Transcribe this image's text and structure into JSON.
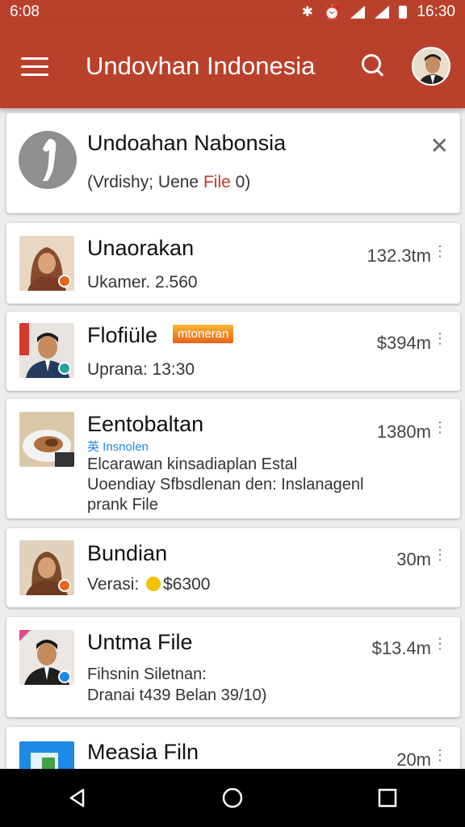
{
  "status": {
    "time_left": "6:08",
    "time_right": "16:30"
  },
  "app": {
    "title": "Undovhan Indonesia"
  },
  "top_card": {
    "title": "Undoahan Nabonsia",
    "sub_prefix": "(Vrdishy; Uene ",
    "sub_file": "File",
    "sub_suffix": " 0)"
  },
  "items": [
    {
      "title": "Unaorakan",
      "sub": "Ukamer.  2.560",
      "meta": "132.3tm"
    },
    {
      "title": "Flofiüle",
      "tag": "mtoneran",
      "sub": "Uprana: 13:30",
      "meta": "$394m"
    },
    {
      "title": "Eentobaltan",
      "tag": "英 Insnolen",
      "lines": [
        "Elcarawan kinsadiaplan Estal",
        "Uoendiay Sfbsdlenan den: Inslanagenl",
        "prank File"
      ],
      "meta": "1380m"
    },
    {
      "title": "Bundian",
      "sub_prefix": "Verasi: ",
      "sub": "$6300",
      "meta": "30m"
    },
    {
      "title": "Untma File",
      "lines": [
        "Fihsnin Siletnan:",
        "Dranai t439 Belan 39/10)"
      ],
      "meta": "$13.4m"
    },
    {
      "title": "Measia Filn",
      "meta": "20m"
    }
  ],
  "colors": {
    "appbar": "#b9412c",
    "accent_orange": "#e8641b",
    "accent_teal": "#26a69a",
    "badge_blue": "#1e88e5"
  },
  "icons": [
    "menu-icon",
    "search-icon",
    "close-icon",
    "back-icon",
    "home-icon",
    "recents-icon"
  ]
}
